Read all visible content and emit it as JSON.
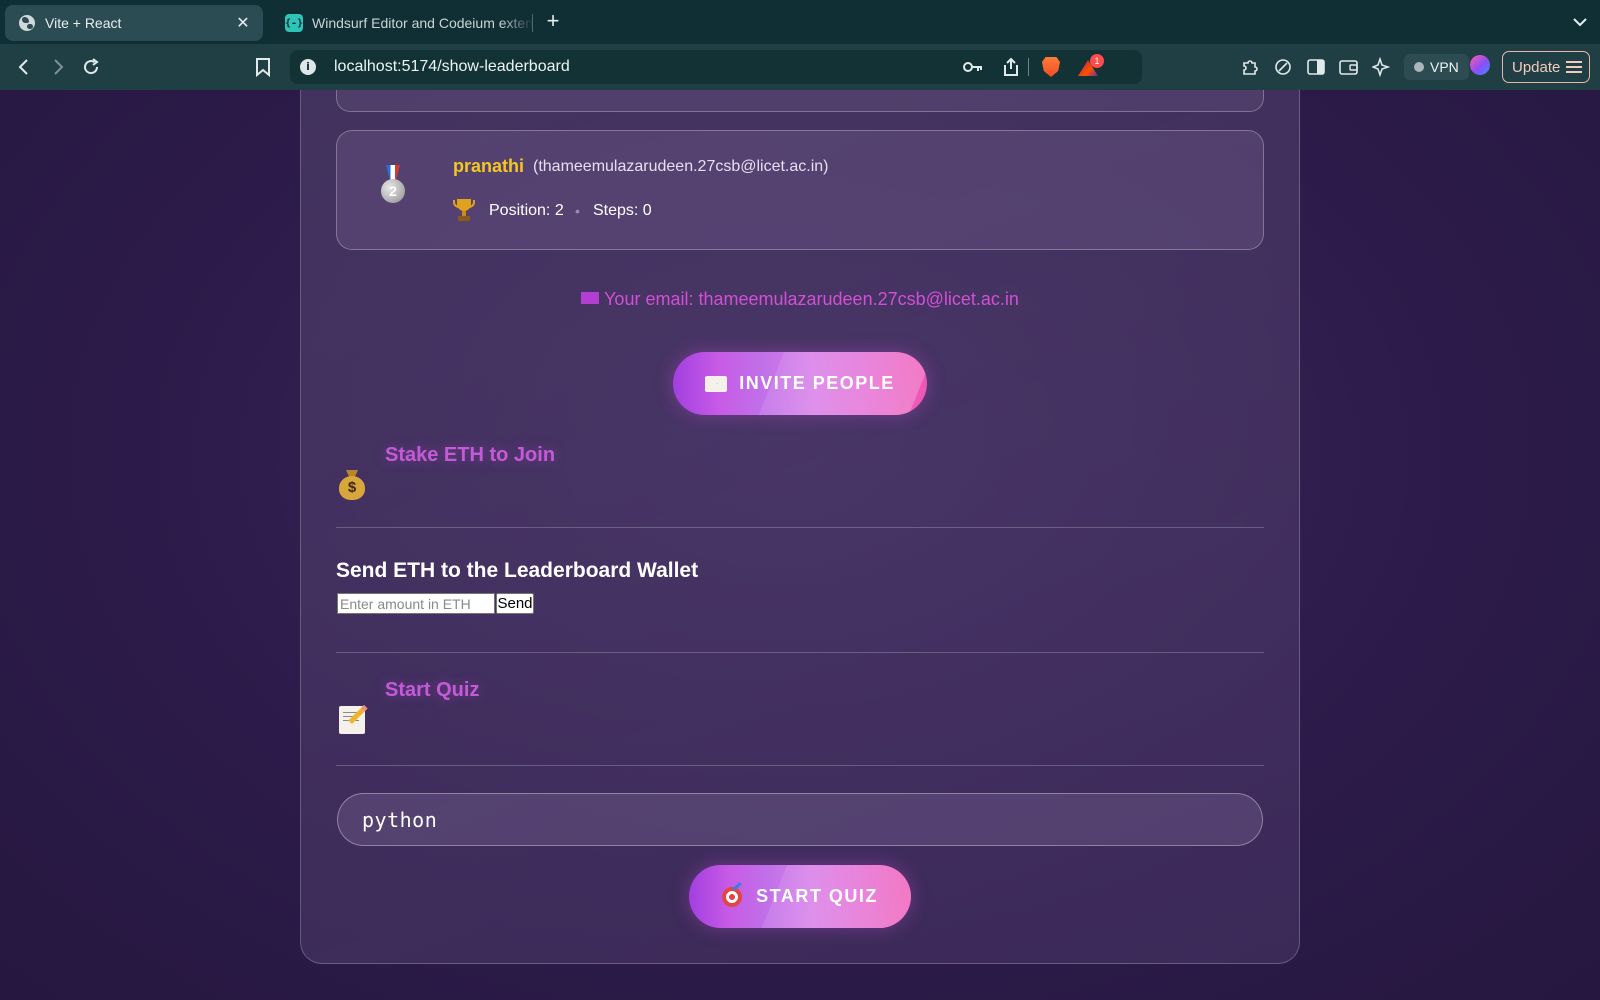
{
  "browser": {
    "tabs": [
      {
        "title": "Vite + React",
        "active": true
      },
      {
        "title": "Windsurf Editor and Codeium extensions",
        "active": false
      }
    ],
    "url": "localhost:5174/show-leaderboard",
    "notification_count": "1",
    "vpn_label": "VPN",
    "update_label": "Update",
    "accent_color": "#0f2f34"
  },
  "leaderboard": {
    "entry": {
      "name": "pranathi",
      "email": "(thameemulazarudeen.27csb@licet.ac.in)",
      "rank_medal": "2",
      "position": "Position: 2",
      "separator": "•",
      "steps": "Steps: 0"
    }
  },
  "user": {
    "email_line": "Your email: thameemulazarudeen.27csb@licet.ac.in"
  },
  "invite": {
    "label": "INVITE PEOPLE",
    "icon": "envelope-icon"
  },
  "stake": {
    "title": "Stake ETH to Join",
    "icon": "moneybag-icon",
    "send_heading": "Send ETH to the Leaderboard Wallet",
    "amount_placeholder": "Enter amount in ETH",
    "send_label": "Send"
  },
  "quiz": {
    "title": "Start Quiz",
    "icon": "memo-icon",
    "topic_value": "python",
    "start_label": "START QUIZ",
    "start_icon": "dart-icon"
  },
  "colors": {
    "name_gold": "#f3c623",
    "section_magenta": "#c45bd6",
    "button_gradient_start": "#a23fe0",
    "button_gradient_end": "#ef56b3"
  }
}
